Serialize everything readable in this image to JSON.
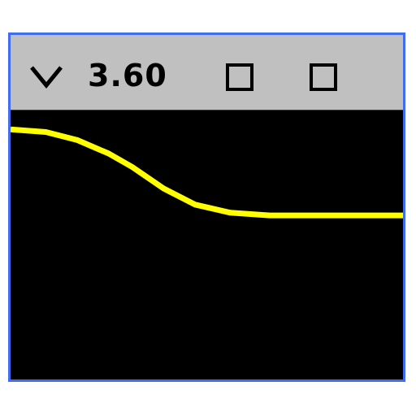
{
  "widget": {
    "value_display": "3.60",
    "chevron_icon": "chevron-down-icon",
    "checkbox_icons": [
      "checkbox-icon",
      "checkbox-icon"
    ],
    "colors": {
      "frame_border": "#3f6cf0",
      "toolbar_bg": "#c0c0c0",
      "plot_bg": "#000000",
      "curve": "#ffff00"
    }
  },
  "chart_data": {
    "type": "line",
    "xlabel": "",
    "ylabel": "",
    "xlim": [
      0,
      1
    ],
    "ylim": [
      0,
      1
    ],
    "grid": false,
    "series": [
      {
        "values": [
          [
            0.0,
            0.93
          ],
          [
            0.09,
            0.92
          ],
          [
            0.17,
            0.89
          ],
          [
            0.25,
            0.84
          ],
          [
            0.31,
            0.79
          ],
          [
            0.39,
            0.71
          ],
          [
            0.47,
            0.65
          ],
          [
            0.56,
            0.62
          ],
          [
            0.66,
            0.61
          ],
          [
            0.75,
            0.61
          ],
          [
            0.85,
            0.61
          ],
          [
            1.0,
            0.61
          ]
        ]
      }
    ]
  }
}
